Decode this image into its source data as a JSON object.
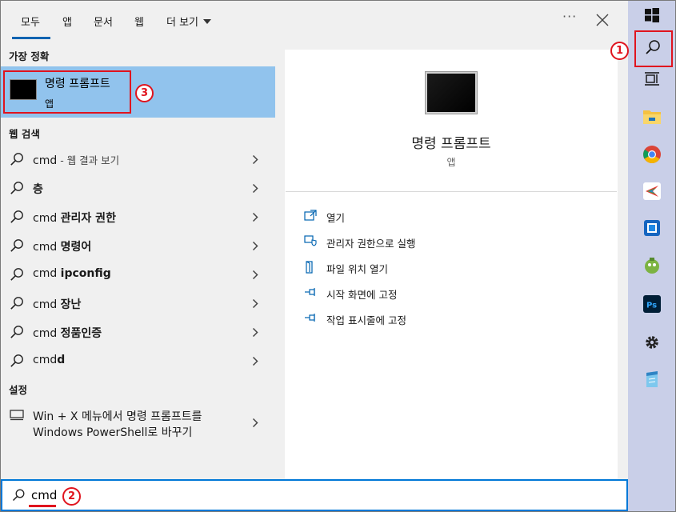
{
  "tabs": [
    {
      "label": "모두",
      "active": true
    },
    {
      "label": "앱"
    },
    {
      "label": "문서"
    },
    {
      "label": "웹"
    },
    {
      "label": "더 보기"
    }
  ],
  "more_label": "···",
  "left": {
    "best_match_header": "가장 정확",
    "best_match": {
      "title": "명령 프롬프트",
      "subtitle": "앱"
    },
    "web_header": "웹 검색",
    "web_results": [
      {
        "prefix": "cmd",
        "suffix": " - 웹 결과 보기",
        "bold": false
      },
      {
        "prefix": "",
        "suffix": "층",
        "bold": true
      },
      {
        "prefix": "cmd ",
        "suffix": "관리자 권한",
        "bold": true
      },
      {
        "prefix": "cmd ",
        "suffix": "명령어",
        "bold": true
      },
      {
        "prefix": "cmd ",
        "suffix": "ipconfig",
        "bold": true
      },
      {
        "prefix": "cmd ",
        "suffix": "장난",
        "bold": true
      },
      {
        "prefix": "cmd ",
        "suffix": "정품인증",
        "bold": true
      },
      {
        "prefix": "cmd",
        "suffix": "d",
        "bold": true
      }
    ],
    "settings_header": "설정",
    "settings_item": {
      "line1": "Win + X 메뉴에서 명령 프롬프트를",
      "line2": "Windows PowerShell로 바꾸기"
    }
  },
  "preview": {
    "title": "명령 프롬프트",
    "subtitle": "앱",
    "actions": [
      {
        "label": "열기",
        "icon": "open-icon"
      },
      {
        "label": "관리자 권한으로 실행",
        "icon": "shield-icon"
      },
      {
        "label": "파일 위치 열기",
        "icon": "file-location-icon"
      },
      {
        "label": "시작 화면에 고정",
        "icon": "pin-icon"
      },
      {
        "label": "작업 표시줄에 고정",
        "icon": "pin-icon"
      }
    ]
  },
  "taskbar": [
    "windows-start-icon",
    "search-icon",
    "task-view-icon",
    "file-explorer-icon",
    "chrome-icon",
    "app-icon",
    "app-icon",
    "app-icon",
    "photoshop-icon",
    "settings-gear-icon",
    "notepad-icon"
  ],
  "photoshop_label": "Ps",
  "search": {
    "query": "cmd"
  },
  "badges": {
    "one": "1",
    "two": "2",
    "three": "3"
  },
  "colors": {
    "accent": "#0078d7",
    "highlight": "#91c3ed",
    "annotation": "#e0141e",
    "taskbar": "#c9cfe8"
  }
}
